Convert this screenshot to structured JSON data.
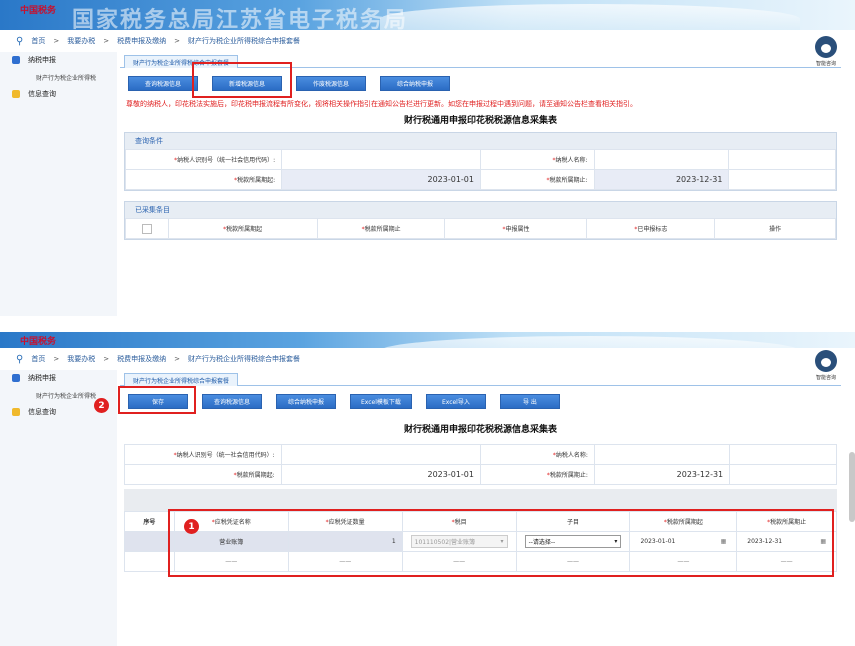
{
  "header": {
    "site_title": "国家税务总局江苏省电子税务局",
    "logo_text": "中国税务"
  },
  "breadcrumb": [
    "首页",
    "我要办税",
    "税费申报及缴纳",
    "财产行为税企业所得税综合申报套餐"
  ],
  "assistant": {
    "label": "智能咨询"
  },
  "sidebar": {
    "items": [
      {
        "label": "纳税申报",
        "icon": "document-icon"
      },
      {
        "label": "信息查询",
        "icon": "chat-icon"
      }
    ],
    "sub_item": "财产行为税企业所得税"
  },
  "tab_label": "财产行为税企业所得税综合申报套餐",
  "screen1": {
    "buttons": [
      "查询税源信息",
      "新增税源信息",
      "作废税源信息",
      "综合纳税申报"
    ],
    "notice": "尊敬的纳税人，印花税法实施后，印花税申报流程有所变化，视将相关操作指引在通知公告栏进行更新。如您在申报过程中遇到问题，请至通知公告栏查看相关指引。",
    "form_title": "财行税通用申报印花税税源信息采集表",
    "query": {
      "heading": "查询条件",
      "taxpayer_id_label": "纳税人识别号（统一社会信用代码）:",
      "taxpayer_name_label": "纳税人名称:",
      "period_start_label": "税款所属期起:",
      "period_start": "2023-01-01",
      "period_end_label": "税款所属期止:",
      "period_end": "2023-12-31"
    },
    "collected": {
      "heading": "已采集条目",
      "columns": [
        "税款所属期起",
        "税款所属期止",
        "申报属性",
        "已申报标志",
        "操作"
      ]
    }
  },
  "screen2": {
    "buttons": [
      "保存",
      "查询税源信息",
      "综合纳税申报",
      "Excel模板下载",
      "Excel导入",
      "导 出"
    ],
    "form_title": "财行税通用申报印花税税源信息采集表",
    "info": {
      "taxpayer_id_label": "纳税人识别号（统一社会信用代码）:",
      "taxpayer_name_label": "纳税人名称:",
      "period_start_label": "税款所属期起:",
      "period_start": "2023-01-01",
      "period_end_label": "税款所属期止:",
      "period_end": "2023-12-31"
    },
    "detail": {
      "row_num_header": "序号",
      "columns": [
        "应税凭证名称",
        "应税凭证数量",
        "税目",
        "子目",
        "税款所属期起",
        "税款所属期止"
      ],
      "row": {
        "voucher_name": "营业账簿",
        "voucher_qty": "1",
        "tax_item": "101110502|营业账簿",
        "sub_item": "--请选择--",
        "period_start": "2023-01-01",
        "period_end": "2023-12-31"
      },
      "dash": "——"
    },
    "badges": [
      "1",
      "2"
    ]
  },
  "colors": {
    "accent": "#2b6cc4",
    "highlight_box": "#e0201f",
    "notice_text": "#e02020"
  }
}
